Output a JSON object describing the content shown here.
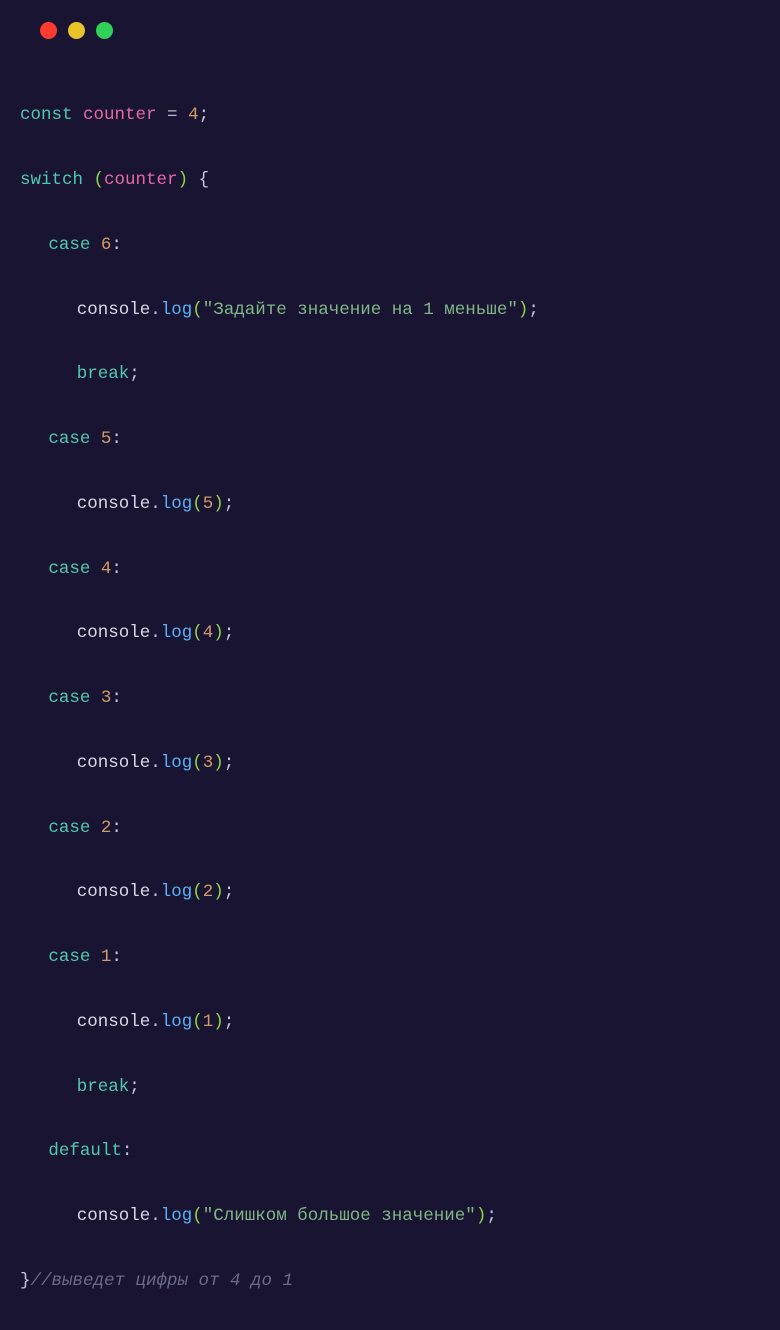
{
  "window": {
    "controls": [
      "close",
      "minimize",
      "maximize"
    ]
  },
  "code": {
    "keyword_const": "const",
    "identifier_counter": "counter",
    "op_assign": " = ",
    "val_4": "4",
    "semicolon": ";",
    "keyword_switch": "switch",
    "space": " ",
    "lparen": "(",
    "rparen": ")",
    "lbrace": "{",
    "rbrace": "}",
    "keyword_case": "case",
    "colon": ":",
    "case6_val": "6",
    "case5_val": "5",
    "case4_val": "4",
    "case3_val": "3",
    "case2_val": "2",
    "case1_val": "1",
    "console": "console",
    "dot": ".",
    "log": "log",
    "str_msg1": "\"Задайте значение на 1 меньше\"",
    "str_msg2": "\"Слишком большое значение\"",
    "arg5": "5",
    "arg4": "4",
    "arg3": "3",
    "arg2": "2",
    "arg1": "1",
    "keyword_break": "break",
    "keyword_default": "default",
    "comment": "//выведет цифры от 4 до 1"
  }
}
